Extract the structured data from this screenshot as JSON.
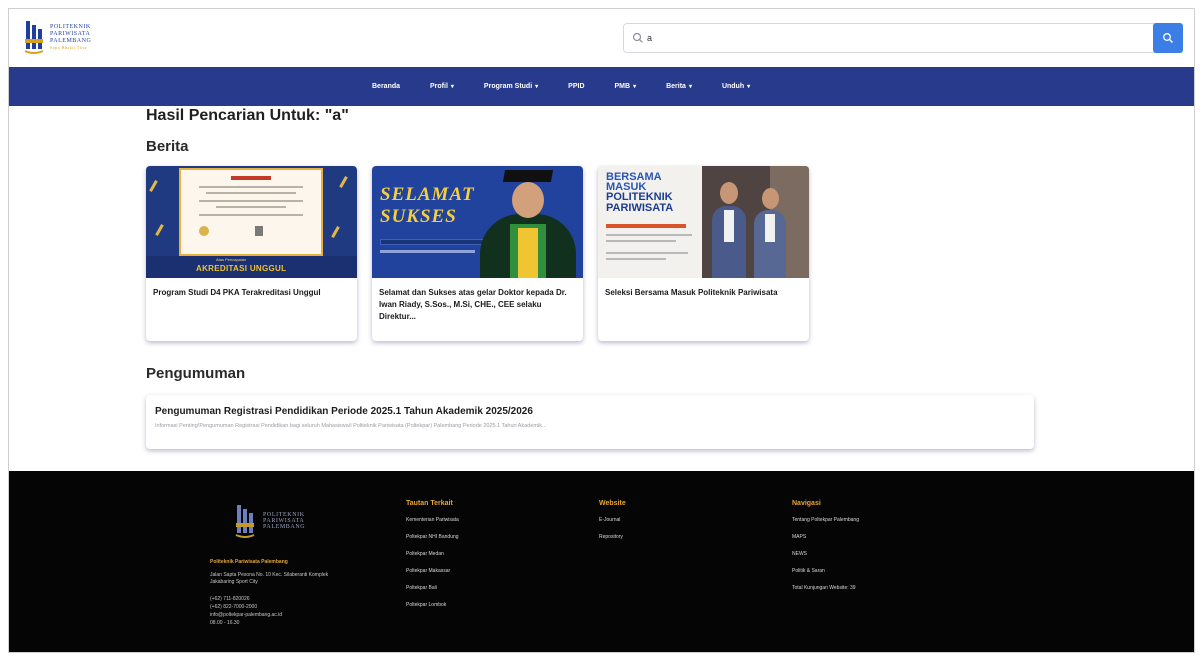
{
  "header": {
    "logo_lines": [
      "POLITEKNIK",
      "PARIWISATA",
      "PALEMBANG"
    ],
    "logo_tagline": "Sopo Bhakti Tirta",
    "search": {
      "value": "a",
      "placeholder": ""
    }
  },
  "nav": {
    "items": [
      {
        "label": "Beranda",
        "dropdown": false
      },
      {
        "label": "Profil",
        "dropdown": true
      },
      {
        "label": "Program Studi",
        "dropdown": true
      },
      {
        "label": "PPID",
        "dropdown": false
      },
      {
        "label": "PMB",
        "dropdown": true
      },
      {
        "label": "Berita",
        "dropdown": true
      },
      {
        "label": "Unduh",
        "dropdown": true
      }
    ],
    "caret": "▾"
  },
  "main": {
    "title": "Hasil Pencarian Untuk: \"a\"",
    "news_heading": "Berita",
    "news": [
      {
        "title": "Program Studi D4 PKA Terakreditasi Unggul",
        "image_caption_small": "Atas Pencapaian",
        "image_caption": "AKREDITASI UNGGUL"
      },
      {
        "title": "Selamat dan Sukses atas gelar Doktor kepada Dr. Iwan Riady, S.Sos., M.Si, CHE., CEE selaku Direktur...",
        "image_line1": "SELAMAT",
        "image_line2": "SUKSES"
      },
      {
        "title": "Seleksi Bersama Masuk Politeknik Pariwisata",
        "image_lines": [
          "BERSAMA",
          "MASUK",
          "POLITEKNIK",
          "PARIWISATA"
        ]
      }
    ],
    "announcements_heading": "Pengumuman",
    "announcements": [
      {
        "title": "Pengumuman Registrasi Pendidikan Periode 2025.1 Tahun Akademik 2025/2026",
        "description": "Informasi Penting!Pengumuman Registrasi Pendidikan bagi seluruh Mahasiswa/i Politeknik Pariwisata (Poltekpar) Palembang Periode 2025.1 Tahun Akademik..."
      }
    ]
  },
  "footer": {
    "logo_lines": [
      "POLITEKNIK",
      "PARIWISATA",
      "PALEMBANG"
    ],
    "institution": "Politeknik Pariwisata Palembang",
    "address": "Jalan Sapta Pesona No. 10 Kec. Silaberanti Komplek Jakabaring Sport City",
    "contacts": [
      "(+62) 711-820026",
      "(+62) 822-7000-2000",
      "info@poltekpar-palembang.ac.id",
      "08.00 - 16.30"
    ],
    "columns": [
      {
        "heading": "Tautan Terkait",
        "links": [
          "Kementerian Pariwisata",
          "Poltekpar NHI Bandung",
          "Poltekpar Medan",
          "Poltekpar Makassar",
          "Poltekpar Bali",
          "Poltekpar Lombok"
        ]
      },
      {
        "heading": "Website",
        "links": [
          "E-Journal",
          "Repository"
        ]
      },
      {
        "heading": "Navigasi",
        "links": [
          "Tentang Poltekpar Palembang",
          "MAPS",
          "NEWS",
          "Politik & Saran",
          "Total Kunjungan Website: 39"
        ]
      }
    ]
  },
  "colors": {
    "nav_bg": "#273a8b",
    "search_button": "#3b7fe6",
    "footer_bg": "#050505",
    "footer_heading": "#e9a632"
  }
}
